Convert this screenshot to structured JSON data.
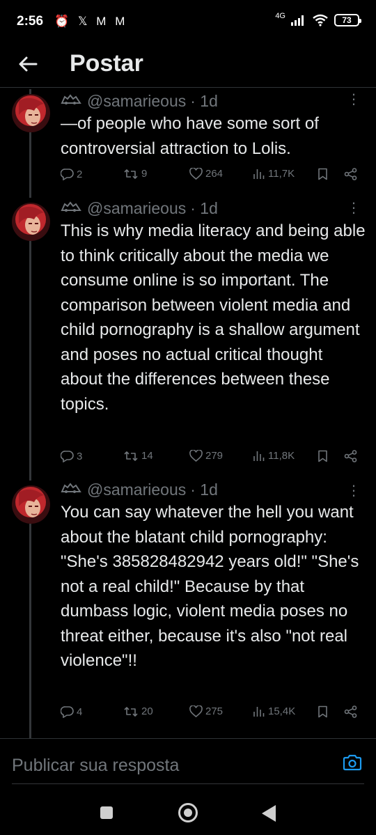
{
  "status_bar": {
    "time": "2:56",
    "notification_glyphs": "⏰ 𝕏 M M",
    "network": "4G",
    "battery": "73"
  },
  "header": {
    "title": "Postar"
  },
  "tweets": [
    {
      "handle": "@samarieous",
      "time": "· 1d",
      "text": "—of people who have some sort of controversial attraction to Lolis.",
      "replies": "2",
      "reposts": "9",
      "likes": "264",
      "views": "11,7K"
    },
    {
      "handle": "@samarieous",
      "time": "· 1d",
      "text": "This is why media literacy and being able to think critically about the media we consume online is so important. The comparison between violent media and child pornography is a shallow argument and poses no actual critical thought about the differences between these topics.",
      "replies": "3",
      "reposts": "14",
      "likes": "279",
      "views": "11,8K"
    },
    {
      "handle": "@samarieous",
      "time": "· 1d",
      "text": "You can say whatever the hell you want about the blatant child pornography: \"She's 385828482942 years old!\" \"She's not a real child!\" Because by that dumbass logic, violent media poses no threat either, because it's also \"not real violence\"!!",
      "replies": "4",
      "reposts": "20",
      "likes": "275",
      "views": "15,4K"
    }
  ],
  "reply_bar": {
    "placeholder": "Publicar sua resposta"
  },
  "colors": {
    "background": "#000000",
    "text": "#e7e9ea",
    "muted": "#71767b",
    "accent": "#1d9bf0",
    "avatar_hair": "#c0282d"
  },
  "icons": [
    "back-arrow-icon",
    "reply-icon",
    "repost-icon",
    "like-icon",
    "views-icon",
    "bookmark-icon",
    "share-icon",
    "more-icon",
    "camera-icon"
  ]
}
